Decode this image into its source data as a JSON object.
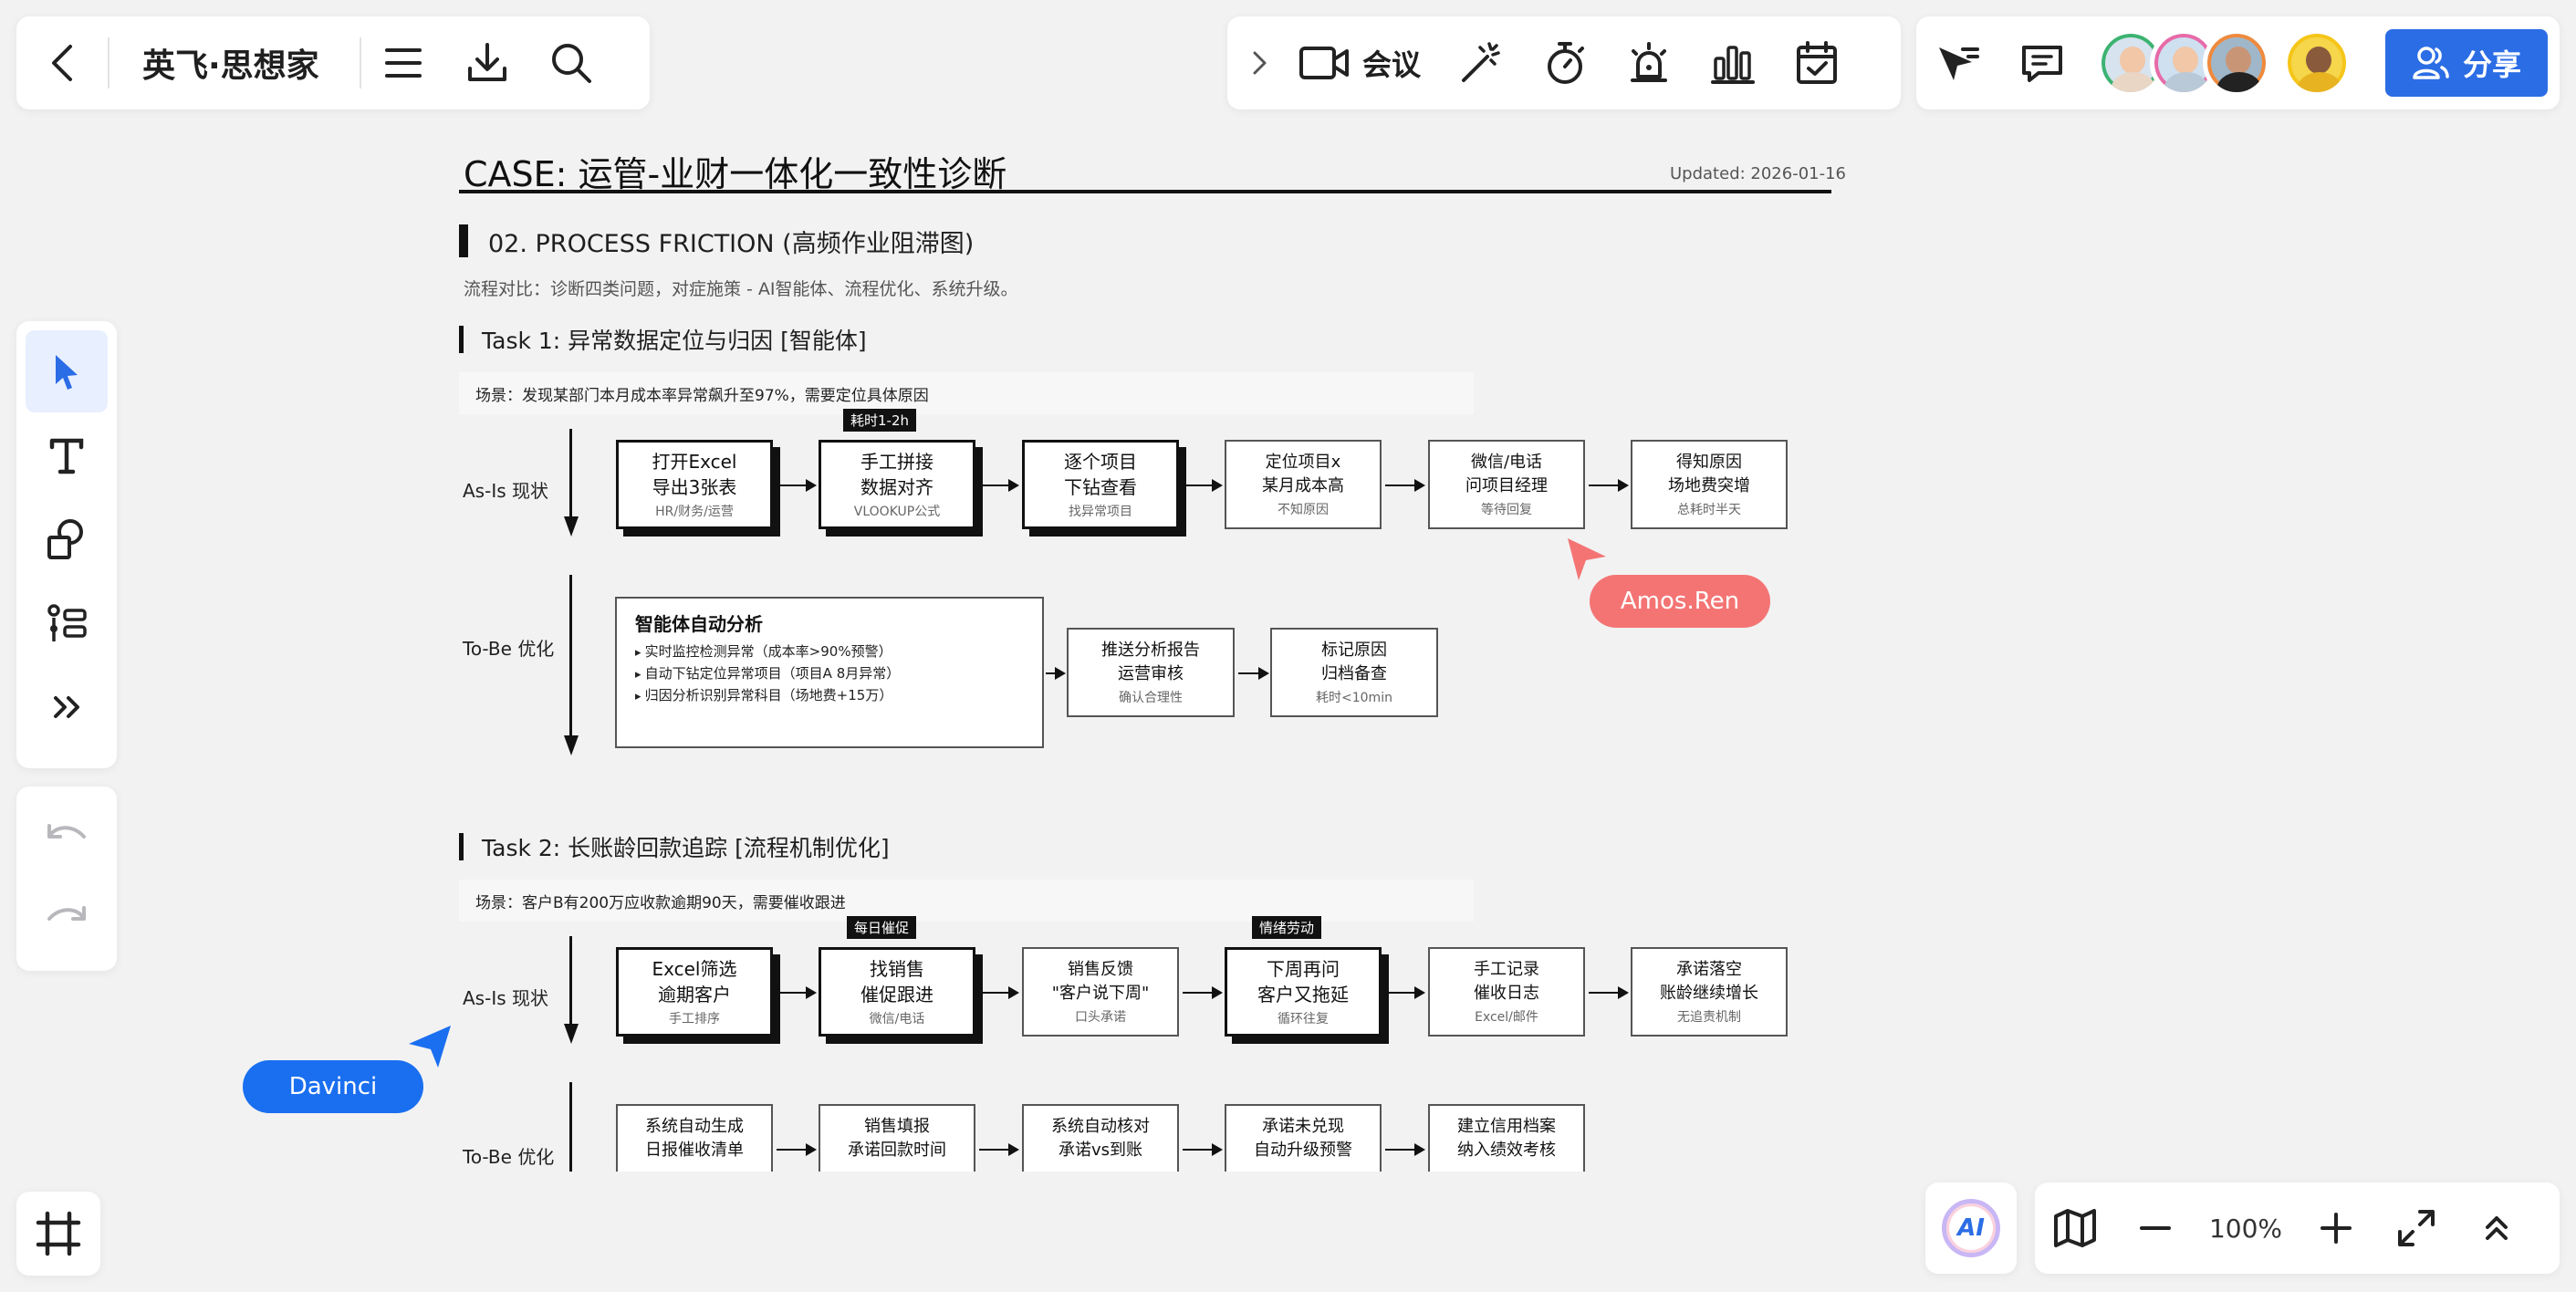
{
  "app": {
    "board_title": "英飞·思想家",
    "meeting_label": "会议",
    "share_label": "分享",
    "zoom_level": "100%",
    "ai_label": "AI",
    "accent": "#2b6de5"
  },
  "avatars": [
    {
      "ring": "#3cb371",
      "shirt": "#e9d6c5"
    },
    {
      "ring": "#e86aa8",
      "shirt": "#b9c9d8"
    },
    {
      "ring": "#f08a3c",
      "shirt": "#222222"
    },
    {
      "ring": "#f5c518",
      "shirt": "#e7b321"
    }
  ],
  "collaborators": [
    {
      "name": "Amos.Ren",
      "color": "#f47474"
    },
    {
      "name": "Davinci",
      "color": "#1a6ff0"
    }
  ],
  "doc": {
    "title": "CASE: 运管-业财一体化一致性诊断",
    "updated": "Updated: 2026-01-16",
    "section": "02. PROCESS FRICTION (高频作业阻滞图)",
    "description": "流程对比：诊断四类问题，对症施策 - AI智能体、流程优化、系统升级。",
    "row_asis": "As-Is 现状",
    "row_tobe": "To-Be 优化",
    "task1": {
      "title": "Task 1: 异常数据定位与归因 [智能体]",
      "scene": "场景：发现某部门本月成本率异常飙升至97%，需要定位具体原因",
      "tag": "耗时1-2h",
      "asis": [
        {
          "l1": "打开Excel",
          "l2": "导出3张表",
          "sub": "HR/财务/运营"
        },
        {
          "l1": "手工拼接",
          "l2": "数据对齐",
          "sub": "VLOOKUP公式"
        },
        {
          "l1": "逐个项目",
          "l2": "下钻查看",
          "sub": "找异常项目"
        },
        {
          "l1": "定位项目x",
          "l2": "某月成本高",
          "sub": "不知原因"
        },
        {
          "l1": "微信/电话",
          "l2": "问项目经理",
          "sub": "等待回复"
        },
        {
          "l1": "得知原因",
          "l2": "场地费突增",
          "sub": "总耗时半天"
        }
      ],
      "tobe_big": {
        "title": "智能体自动分析",
        "items": [
          "实时监控检测异常（成本率>90%预警）",
          "自动下钻定位异常项目（项目A 8月异常）",
          "归因分析识别异常科目（场地费+15万）"
        ]
      },
      "tobe": [
        {
          "l1": "推送分析报告",
          "l2": "运营审核",
          "sub": "确认合理性"
        },
        {
          "l1": "标记原因",
          "l2": "归档备查",
          "sub": "耗时<10min"
        }
      ]
    },
    "task2": {
      "title": "Task 2: 长账龄回款追踪 [流程机制优化]",
      "scene": "场景：客户B有200万应收款逾期90天，需要催收跟进",
      "tag_a": "每日催促",
      "tag_b": "情绪劳动",
      "asis": [
        {
          "l1": "Excel筛选",
          "l2": "逾期客户",
          "sub": "手工排序"
        },
        {
          "l1": "找销售",
          "l2": "催促跟进",
          "sub": "微信/电话"
        },
        {
          "l1": "销售反馈",
          "l2": "\"客户说下周\"",
          "sub": "口头承诺"
        },
        {
          "l1": "下周再问",
          "l2": "客户又拖延",
          "sub": "循环往复"
        },
        {
          "l1": "手工记录",
          "l2": "催收日志",
          "sub": "Excel/邮件"
        },
        {
          "l1": "承诺落空",
          "l2": "账龄继续增长",
          "sub": "无追责机制"
        }
      ],
      "tobe": [
        {
          "l1": "系统自动生成",
          "l2": "日报催收清单"
        },
        {
          "l1": "销售填报",
          "l2": "承诺回款时间"
        },
        {
          "l1": "系统自动核对",
          "l2": "承诺vs到账"
        },
        {
          "l1": "承诺未兑现",
          "l2": "自动升级预警"
        },
        {
          "l1": "建立信用档案",
          "l2": "纳入绩效考核"
        }
      ]
    }
  }
}
